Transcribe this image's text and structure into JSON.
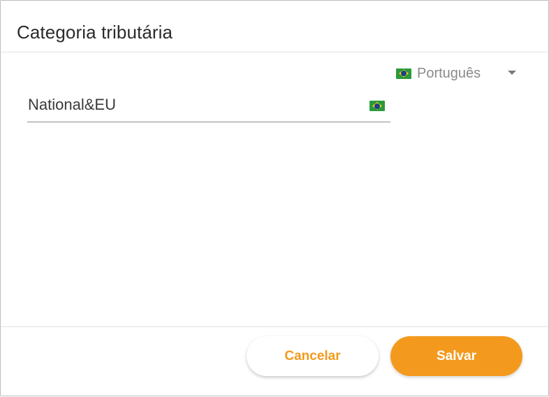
{
  "dialog": {
    "title": "Categoria tributária",
    "language": {
      "selected": "Português",
      "flag_icon": "brazil-flag-icon"
    },
    "field": {
      "value": "National&EU",
      "flag_icon": "brazil-flag-icon"
    },
    "buttons": {
      "cancel_label": "Cancelar",
      "save_label": "Salvar"
    }
  },
  "colors": {
    "accent": "#f39a1e",
    "title_text": "#2b2b2b",
    "muted_text": "#8a8a8a"
  }
}
